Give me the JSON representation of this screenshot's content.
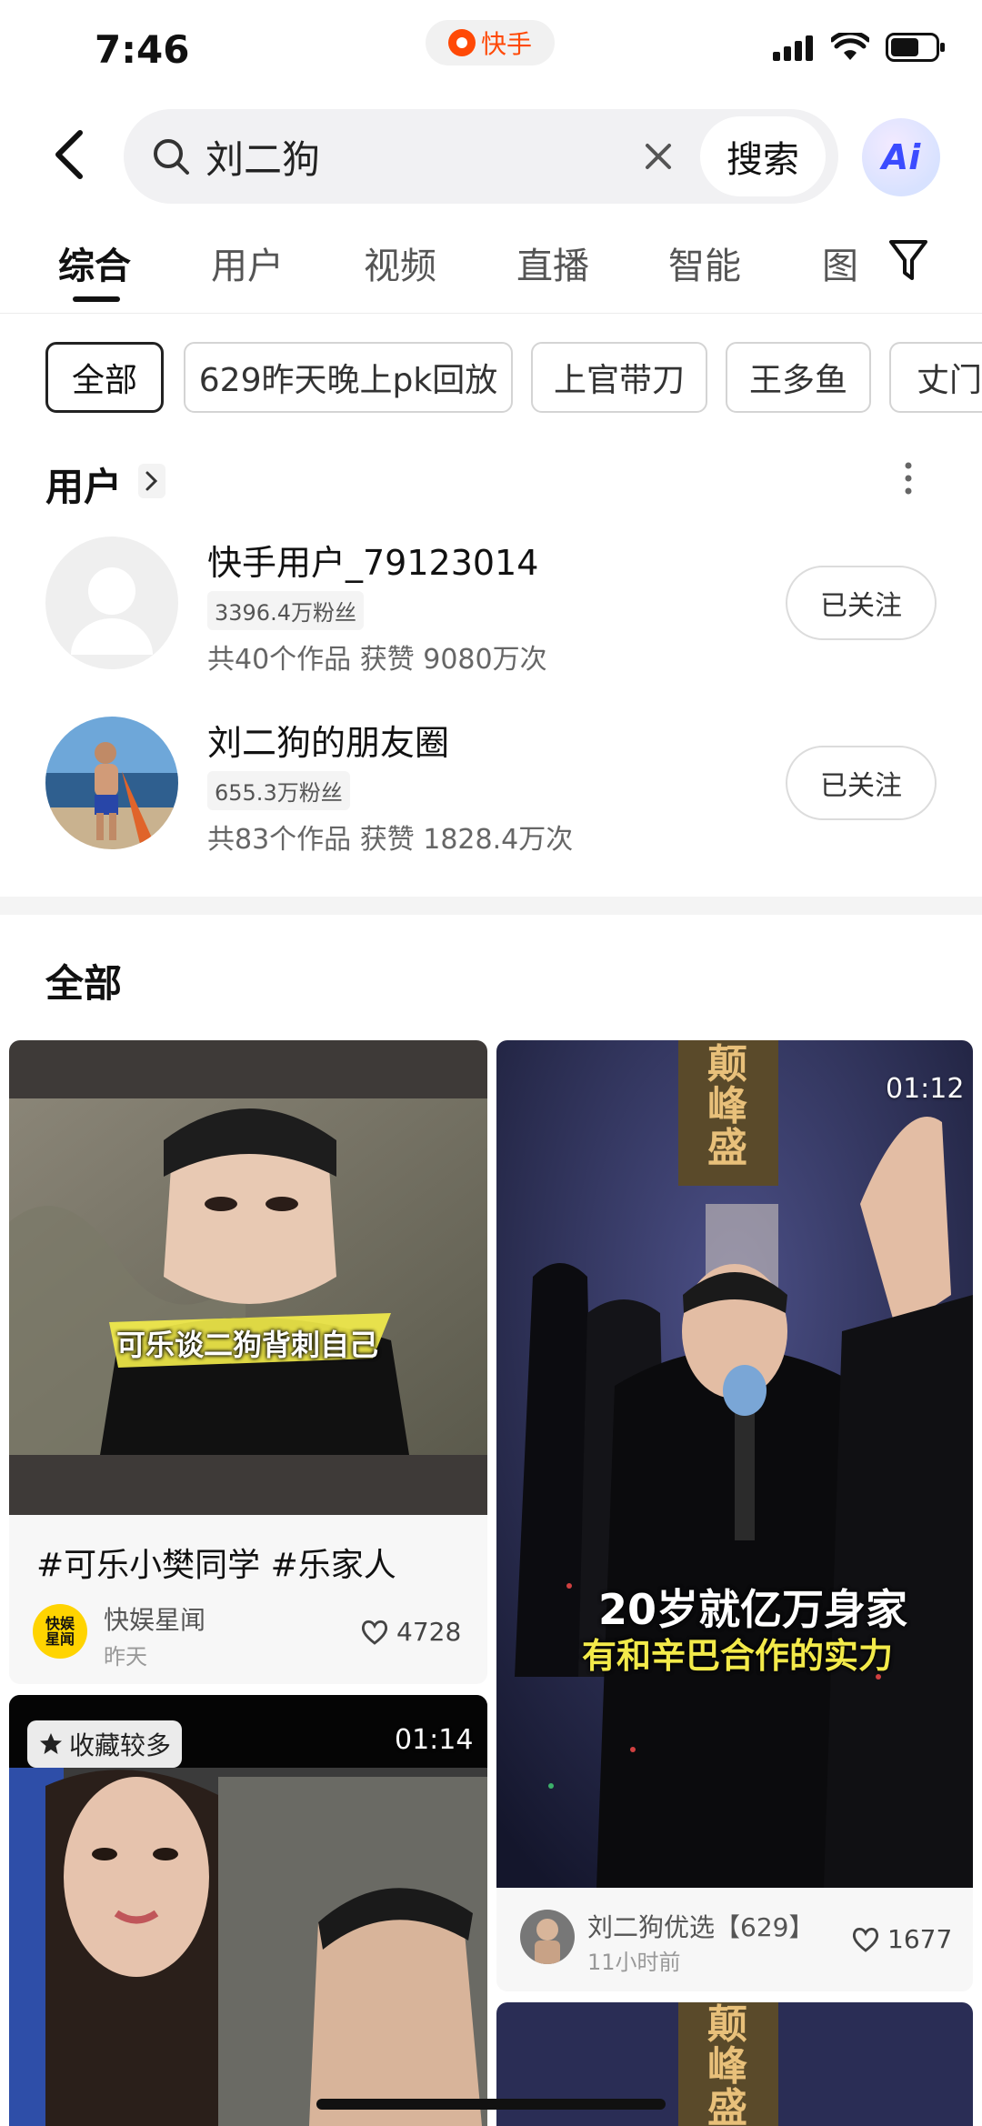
{
  "status_bar": {
    "time": "7:46",
    "app_name": "快手"
  },
  "search": {
    "query": "刘二狗",
    "button_label": "搜索",
    "ai_label": "Ai"
  },
  "tabs": [
    {
      "label": "综合",
      "active": true
    },
    {
      "label": "用户"
    },
    {
      "label": "视频"
    },
    {
      "label": "直播"
    },
    {
      "label": "智能"
    },
    {
      "label": "图"
    }
  ],
  "chips": [
    "全部",
    "629昨天晚上pk回放",
    "上官带刀",
    "王多鱼",
    "丈门"
  ],
  "users_section": {
    "title": "用户",
    "users": [
      {
        "name": "快手用户_79123014",
        "fans": "3396.4万粉丝",
        "stats": "共40个作品 获赞 9080万次",
        "follow_label": "已关注"
      },
      {
        "name": "刘二狗的朋友圈",
        "fans": "655.3万粉丝",
        "stats": "共83个作品 获赞 1828.4万次",
        "follow_label": "已关注"
      }
    ]
  },
  "all_section": {
    "title": "全部"
  },
  "feed": {
    "left_card": {
      "overlay": "可乐谈二狗背刺自己",
      "title": "#可乐小樊同学 #乐家人",
      "author_badge": "快娱星闻",
      "author": "快娱星闻",
      "time": "昨天",
      "likes": "4728"
    },
    "right_card": {
      "duration": "01:12",
      "top_text": "颠峰盛",
      "caption_1": "20岁就亿万身家",
      "caption_2": "有和辛巴合作的实力",
      "author": "刘二狗优选【629】",
      "time": "11小时前",
      "likes": "1677"
    },
    "left_card_2": {
      "badge": "收藏较多",
      "duration": "01:14"
    },
    "right_card_2": {
      "top_text": "颠峰盛"
    }
  }
}
